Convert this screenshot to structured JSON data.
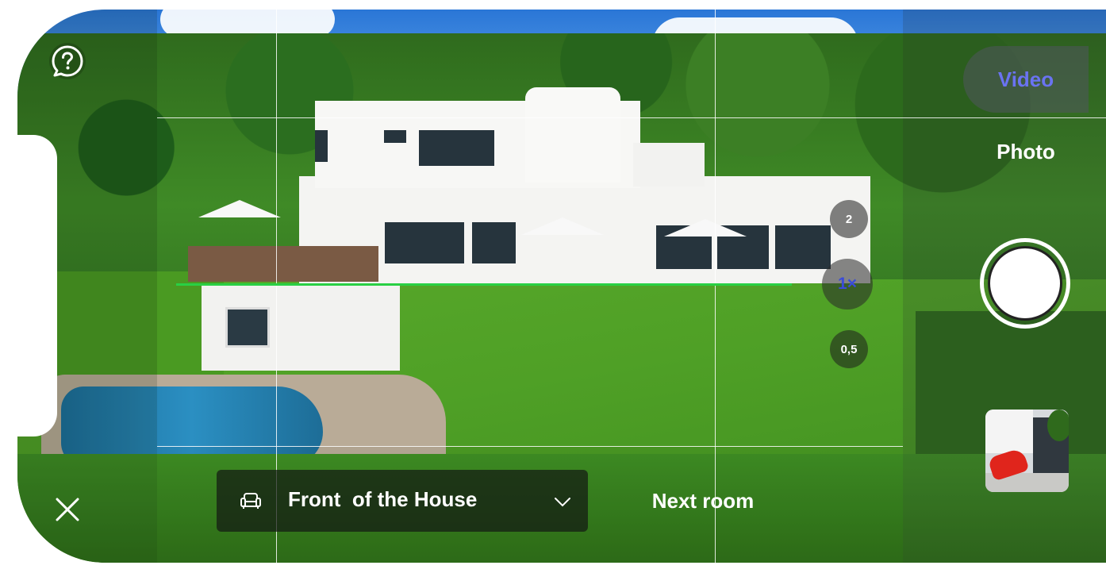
{
  "top_left": {
    "help_icon": "help-question-bubble"
  },
  "bottom_left": {
    "close_icon": "close-x"
  },
  "zoom": {
    "levels": [
      "2",
      "1×",
      "0,5"
    ],
    "selected": "1×"
  },
  "modes": {
    "video_label": "Video",
    "photo_label": "Photo",
    "selected": "Video"
  },
  "room": {
    "icon": "sofa-icon",
    "label": "Front  of the House",
    "next_label": "Next room"
  },
  "colors": {
    "accent": "#6a73f2",
    "level_line": "#29d044"
  },
  "shutter": {
    "icon": "shutter-button"
  }
}
